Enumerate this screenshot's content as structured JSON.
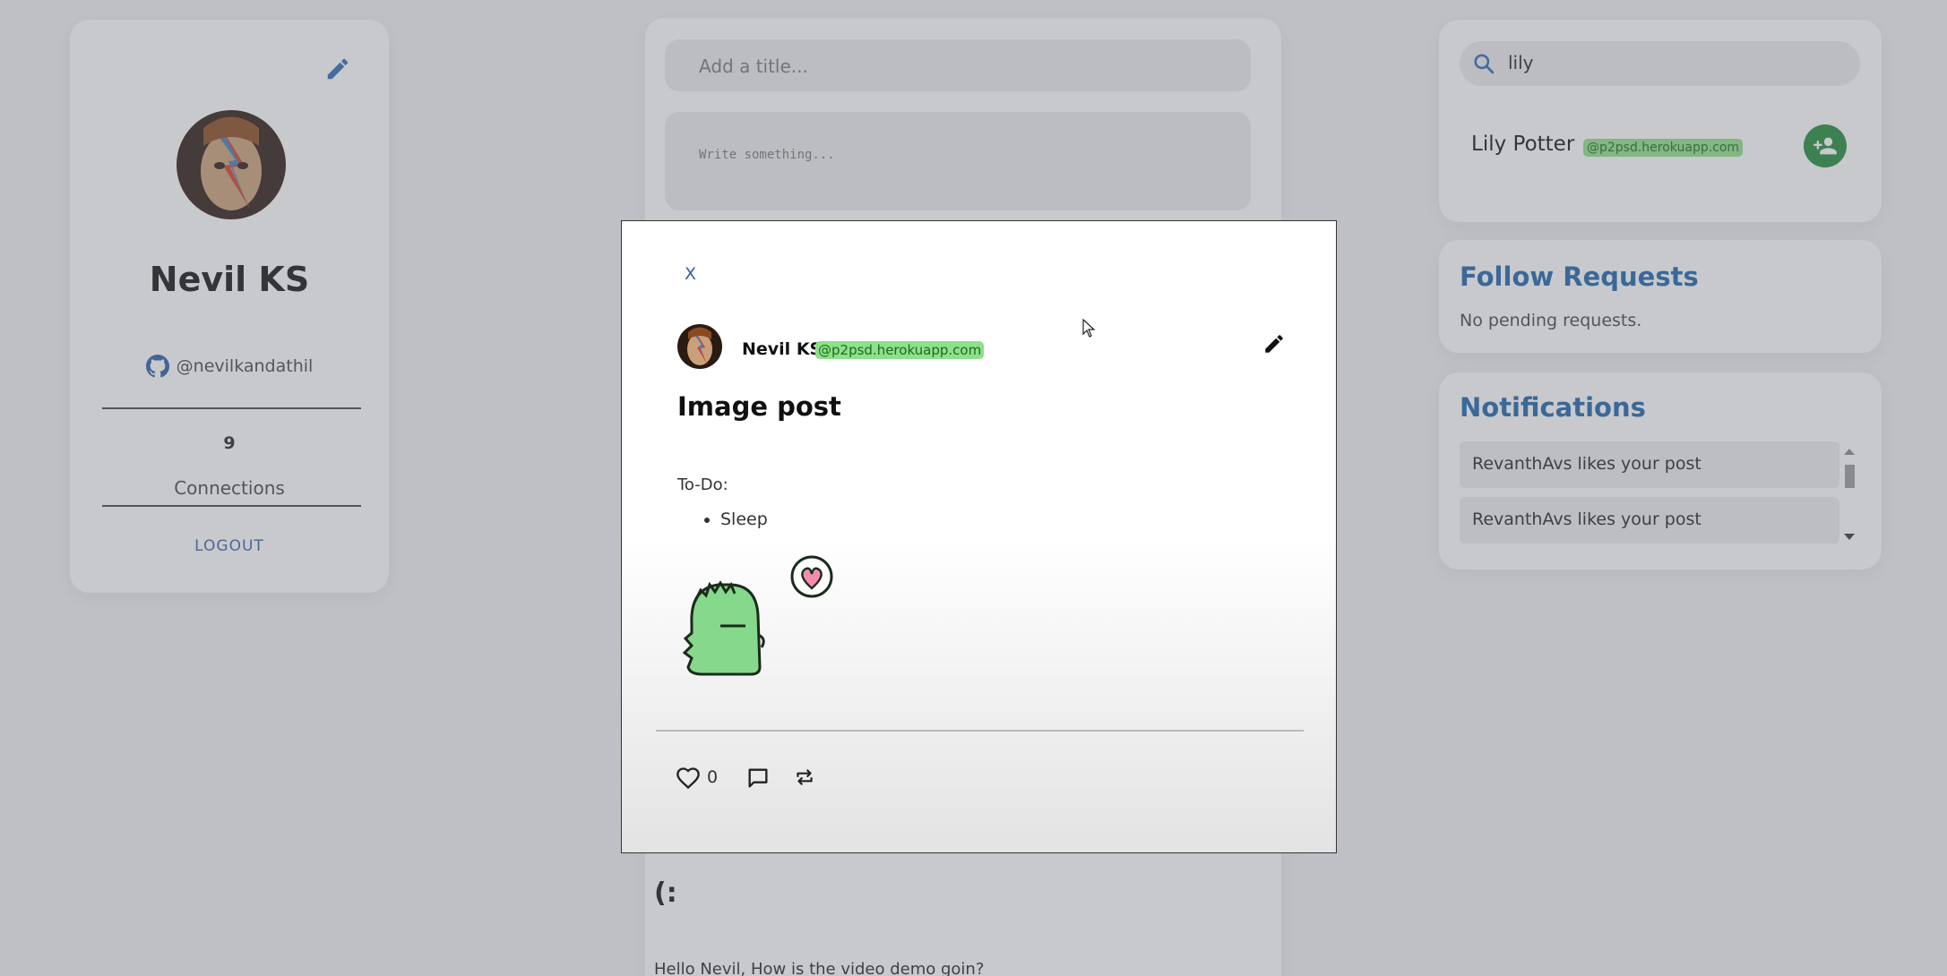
{
  "profile": {
    "name": "Nevil KS",
    "github_handle": "@nevilkandathil",
    "connections_count": "9",
    "connections_label": "Connections",
    "logout_label": "LOGOUT"
  },
  "composer": {
    "title_placeholder": "Add a title...",
    "body_placeholder": "Write something..."
  },
  "feed": {
    "post_title": "(:",
    "post_body": "Hello Nevil, How is the video demo goin?"
  },
  "search": {
    "value": "lily",
    "result": {
      "name": "Lily Potter",
      "email": "@p2psd.herokuapp.com"
    }
  },
  "follow_requests": {
    "heading": "Follow Requests",
    "empty_text": "No pending requests."
  },
  "notifications": {
    "heading": "Notifications",
    "items": [
      {
        "text": "RevanthAvs likes your post"
      },
      {
        "text": "RevanthAvs likes your post"
      }
    ]
  },
  "modal": {
    "close_label": "X",
    "author": "Nevil KS",
    "author_email": "@p2psd.herokuapp.com",
    "title": "Image post",
    "todo_label": "To-Do:",
    "list_items": [
      "Sleep"
    ],
    "like_count": "0"
  },
  "colors": {
    "accent_blue": "#1a63ad",
    "email_badge": "#8ee08a",
    "add_button_green": "#1f8b3b"
  }
}
